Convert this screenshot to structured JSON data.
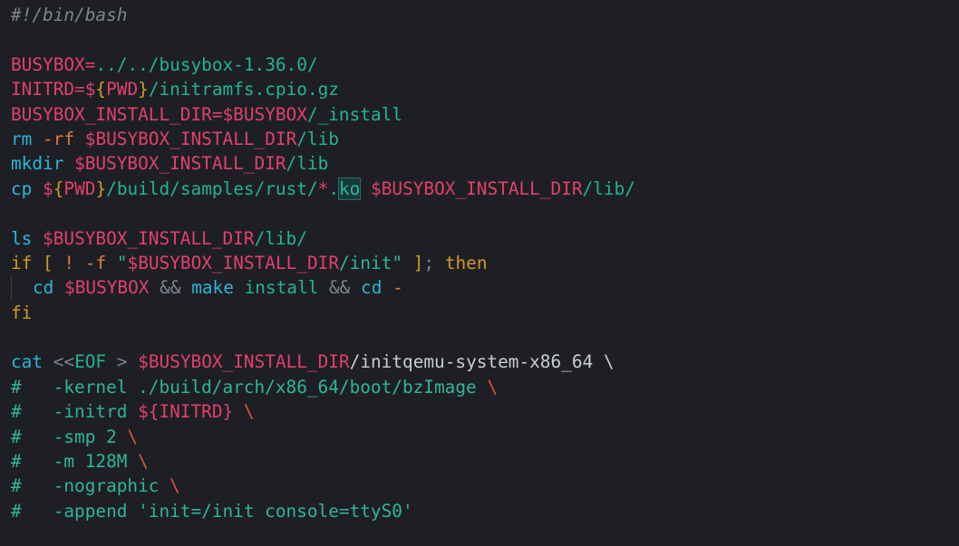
{
  "editor": {
    "background": "#1e1f24",
    "lines": [
      [
        {
          "t": "#!/bin/bash",
          "c": "comment-italic"
        }
      ],
      [],
      [
        {
          "t": "BUSYBOX",
          "c": "var"
        },
        {
          "t": "=",
          "c": "var"
        },
        {
          "t": "../../busybox-1.36.0/",
          "c": "path"
        }
      ],
      [
        {
          "t": "INITRD",
          "c": "var"
        },
        {
          "t": "=",
          "c": "var"
        },
        {
          "t": "$",
          "c": "var"
        },
        {
          "t": "{",
          "c": "brace"
        },
        {
          "t": "PWD",
          "c": "var"
        },
        {
          "t": "}",
          "c": "brace"
        },
        {
          "t": "/initramfs.cpio.gz",
          "c": "path"
        }
      ],
      [
        {
          "t": "BUSYBOX_INSTALL_DIR",
          "c": "var"
        },
        {
          "t": "=",
          "c": "var"
        },
        {
          "t": "$BUSYBOX",
          "c": "var"
        },
        {
          "t": "/_install",
          "c": "path"
        }
      ],
      [
        {
          "t": "rm",
          "c": "cmd"
        },
        {
          "t": " ",
          "c": "plain"
        },
        {
          "t": "-rf",
          "c": "flag"
        },
        {
          "t": " ",
          "c": "plain"
        },
        {
          "t": "$BUSYBOX_INSTALL_DIR",
          "c": "var"
        },
        {
          "t": "/lib",
          "c": "path"
        }
      ],
      [
        {
          "t": "mkdir",
          "c": "cmd"
        },
        {
          "t": " ",
          "c": "plain"
        },
        {
          "t": "$BUSYBOX_INSTALL_DIR",
          "c": "var"
        },
        {
          "t": "/lib",
          "c": "path"
        }
      ],
      [
        {
          "t": "cp",
          "c": "cmd"
        },
        {
          "t": " ",
          "c": "plain"
        },
        {
          "t": "$",
          "c": "var"
        },
        {
          "t": "{",
          "c": "brace"
        },
        {
          "t": "PWD",
          "c": "var"
        },
        {
          "t": "}",
          "c": "brace"
        },
        {
          "t": "/build/samples/rust/",
          "c": "path"
        },
        {
          "t": "*",
          "c": "var"
        },
        {
          "t": ".",
          "c": "path"
        },
        {
          "t": "ko",
          "c": "hl"
        },
        {
          "t": " ",
          "c": "plain"
        },
        {
          "t": "$BUSYBOX_INSTALL_DIR",
          "c": "var"
        },
        {
          "t": "/lib/",
          "c": "path"
        }
      ],
      [],
      [
        {
          "t": "ls",
          "c": "cmd"
        },
        {
          "t": " ",
          "c": "plain"
        },
        {
          "t": "$BUSYBOX_INSTALL_DIR",
          "c": "var"
        },
        {
          "t": "/lib/",
          "c": "path"
        }
      ],
      [
        {
          "t": "if",
          "c": "kw"
        },
        {
          "t": " ",
          "c": "plain"
        },
        {
          "t": "[",
          "c": "kw"
        },
        {
          "t": " ",
          "c": "plain"
        },
        {
          "t": "!",
          "c": "flag"
        },
        {
          "t": " ",
          "c": "plain"
        },
        {
          "t": "-f",
          "c": "flag"
        },
        {
          "t": " ",
          "c": "plain"
        },
        {
          "t": "\"",
          "c": "str"
        },
        {
          "t": "$BUSYBOX_INSTALL_DIR",
          "c": "var"
        },
        {
          "t": "/init\"",
          "c": "str"
        },
        {
          "t": " ",
          "c": "plain"
        },
        {
          "t": "]",
          "c": "kw"
        },
        {
          "t": ";",
          "c": "dim"
        },
        {
          "t": " ",
          "c": "plain"
        },
        {
          "t": "then",
          "c": "kw"
        }
      ],
      [
        {
          "t": "INDENT",
          "c": "indent"
        },
        {
          "t": "cd",
          "c": "cmd"
        },
        {
          "t": " ",
          "c": "plain"
        },
        {
          "t": "$BUSYBOX",
          "c": "var"
        },
        {
          "t": " ",
          "c": "plain"
        },
        {
          "t": "&&",
          "c": "dim"
        },
        {
          "t": " ",
          "c": "plain"
        },
        {
          "t": "make",
          "c": "cmd"
        },
        {
          "t": " ",
          "c": "plain"
        },
        {
          "t": "install",
          "c": "path"
        },
        {
          "t": " ",
          "c": "plain"
        },
        {
          "t": "&&",
          "c": "dim"
        },
        {
          "t": " ",
          "c": "plain"
        },
        {
          "t": "cd",
          "c": "cmd"
        },
        {
          "t": " ",
          "c": "plain"
        },
        {
          "t": "-",
          "c": "flag"
        }
      ],
      [
        {
          "t": "fi",
          "c": "kw"
        }
      ],
      [],
      [
        {
          "t": "cat",
          "c": "cmd"
        },
        {
          "t": " ",
          "c": "plain"
        },
        {
          "t": "<<",
          "c": "dim"
        },
        {
          "t": "EOF",
          "c": "path"
        },
        {
          "t": " ",
          "c": "plain"
        },
        {
          "t": ">",
          "c": "dim"
        },
        {
          "t": " ",
          "c": "plain"
        },
        {
          "t": "$BUSYBOX_INSTALL_DIR",
          "c": "var"
        },
        {
          "t": "/initqemu-system-x86_64 \\",
          "c": "plain"
        }
      ],
      [
        {
          "t": "#   -kernel ./build/arch/x86_64/boot/bzImage ",
          "c": "comment"
        },
        {
          "t": "\\",
          "c": "esc"
        }
      ],
      [
        {
          "t": "#   -initrd ",
          "c": "comment"
        },
        {
          "t": "${INITRD}",
          "c": "var"
        },
        {
          "t": " ",
          "c": "plain"
        },
        {
          "t": "\\",
          "c": "esc"
        }
      ],
      [
        {
          "t": "#   -smp 2 ",
          "c": "comment"
        },
        {
          "t": "\\",
          "c": "esc"
        }
      ],
      [
        {
          "t": "#   -m 128M ",
          "c": "comment"
        },
        {
          "t": "\\",
          "c": "esc"
        }
      ],
      [
        {
          "t": "#   -nographic ",
          "c": "comment"
        },
        {
          "t": "\\",
          "c": "esc"
        }
      ],
      [
        {
          "t": "#   -append 'init=/init console=ttyS0'",
          "c": "comment"
        }
      ]
    ]
  }
}
